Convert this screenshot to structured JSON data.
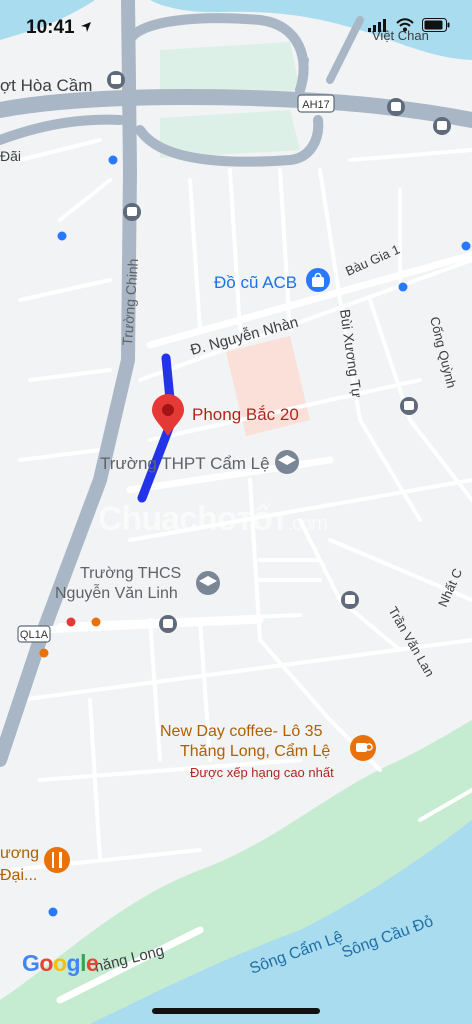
{
  "status_bar": {
    "time": "10:41"
  },
  "map": {
    "colors": {
      "water": "#a8dcee",
      "park": "#c5ecd0",
      "road": "#ffffff",
      "highway": "#a9b6c5",
      "route": "#2233e8",
      "pin": "#e53935",
      "poi_blue": "#2979ff",
      "poi_orange": "#e8710a"
    },
    "labels": {
      "hoa_cam": "ợt Hòa Cầm",
      "viet_chan": "Việt Chan",
      "dai_top": "Đãi",
      "ah17": "AH17",
      "truong_chinh": "Trường Chinh",
      "do_cu_acb": "Đồ cũ ACB",
      "bau_gia": "Bàu Gia 1",
      "nguyen_nhan": "Đ. Nguyễn Nhàn",
      "bui_xuong_tu": "Bùi Xương Tự",
      "cong_quynh": "Cống Quỳnh",
      "phong_bac": "Phong Bắc 20",
      "thpt": "Trường THPT Cẩm Lệ",
      "thcs_1": "Trường THCS",
      "thcs_2": "Nguyễn Văn Linh",
      "nhat_c": "Nhất C",
      "ql1a": "QL1A",
      "tran_van_lan": "Trần Văn Lan",
      "newday_1": "New Day coffee- Lô 35",
      "newday_2": "Thăng Long, Cẩm Lệ",
      "newday_3": "Được xếp hạng cao nhất",
      "restaurant_1": "ương",
      "restaurant_2": "Đại...",
      "thang_long": "hăng Long",
      "song_cam_le": "Sông Cẩm Lệ",
      "song_cau_do": "Sông Cầu Đỏ"
    }
  },
  "branding": {
    "google": "Google",
    "watermark_1": "Chuachoтốт",
    "watermark_2": ".com"
  }
}
